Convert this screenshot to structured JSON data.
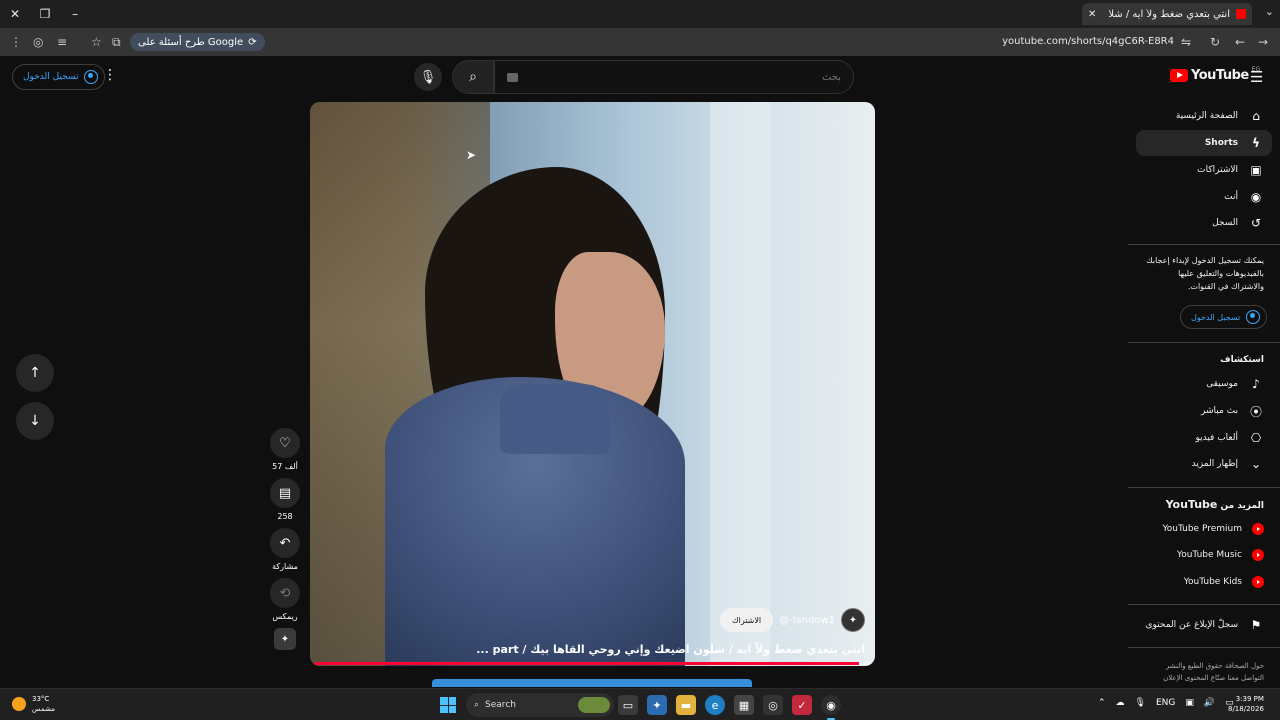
{
  "browser": {
    "tab_title": "انتي بتعدي ضغط ولاّ ايه / شلا",
    "url": "youtube.com/shorts/q4gC6R-E8R4",
    "google_chip": "طرح أسئلة على Google"
  },
  "header": {
    "signin_label": "تسجيل الدخول",
    "search_placeholder": "بحث",
    "logo_text": "YouTube",
    "region": "EG"
  },
  "short": {
    "channel": "@-landow1",
    "subscribe_label": "الاشتراك",
    "title": "انتي بتعدي ضغط ولاّ ايه / شلون اضيعك وإني روحي القاها بيك / part ...",
    "progress_fraction": 0.98
  },
  "actions": {
    "likes": "57 ألف",
    "comments": "258",
    "share_label": "مشاركة",
    "remix_label": "ريمكس"
  },
  "sidebar": {
    "main": [
      {
        "label": "الصفحة الرئيسية",
        "icon": "home-icon"
      },
      {
        "label": "Shorts",
        "icon": "shorts-icon"
      },
      {
        "label": "الاشتراكات",
        "icon": "subscriptions-icon"
      },
      {
        "label": "أنت",
        "icon": "you-icon"
      },
      {
        "label": "السجل",
        "icon": "history-icon"
      }
    ],
    "signin_message": "يمكنك تسجيل الدخول لإبداء إعجابك بالفيديوهات والتعليق عليها والاشتراك في القنوات.",
    "signin_label": "تسجيل الدخول",
    "explore_heading": "استكشاف",
    "explore": [
      {
        "label": "موسيقى",
        "icon": "music-icon"
      },
      {
        "label": "بث مباشر",
        "icon": "live-icon"
      },
      {
        "label": "ألعاب فيديو",
        "icon": "gaming-icon"
      },
      {
        "label": "إظهار المزيد",
        "icon": "chevron-down-icon"
      }
    ],
    "more_heading_prefix": "المزيد من",
    "more_heading_brand": "YouTube",
    "more": [
      {
        "label": "YouTube Premium"
      },
      {
        "label": "YouTube Music"
      },
      {
        "label": "YouTube Kids"
      }
    ],
    "report_label": "سجلّ الإبلاغ عن المحتوى",
    "footer": "حول  الصحافة  حقوق الطبع والنشر  التواصل معنا  صنّاع المحتوى  الإعلان"
  },
  "taskbar": {
    "temperature": "33°C",
    "weather": "مشمس",
    "search_label": "Search",
    "language": "ENG",
    "time": "3:39 PM",
    "date": "8/18/2026"
  }
}
